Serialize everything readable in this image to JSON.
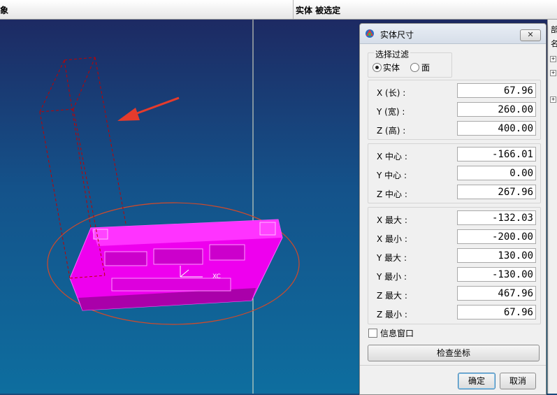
{
  "topbar": {
    "left_label": "象",
    "status": "实体 被选定"
  },
  "right_strip": {
    "label": "部",
    "glyph": "名"
  },
  "dialog": {
    "title": "实体尺寸",
    "close_label": "✕",
    "filter": {
      "legend": "选择过滤",
      "options": [
        {
          "label": "实体",
          "checked": true
        },
        {
          "label": "面",
          "checked": false
        }
      ]
    },
    "dimensions": [
      {
        "label": "X (长) :",
        "value": "67.96"
      },
      {
        "label": "Y (宽) :",
        "value": "260.00"
      },
      {
        "label": "Z (高) :",
        "value": "400.00"
      }
    ],
    "centers": [
      {
        "label": "X 中心 :",
        "value": "-166.01"
      },
      {
        "label": "Y 中心 :",
        "value": "0.00"
      },
      {
        "label": "Z 中心 :",
        "value": "267.96"
      }
    ],
    "extents": [
      {
        "label": "X 最大 :",
        "value": "-132.03"
      },
      {
        "label": "X 最小 :",
        "value": "-200.00"
      },
      {
        "label": "Y 最大 :",
        "value": "130.00"
      },
      {
        "label": "Y 最小 :",
        "value": "-130.00"
      },
      {
        "label": "Z 最大 :",
        "value": "467.96"
      },
      {
        "label": "Z 最小 :",
        "value": "67.96"
      }
    ],
    "info_window_label": "信息窗口",
    "check_coords_label": "检查坐标",
    "ok_label": "确定",
    "cancel_label": "取消"
  },
  "viewport": {
    "axis_label": "XC",
    "model_color": "#ff00ff",
    "bbox_color": "#c00000",
    "arrow_color": "#e53b2c"
  }
}
